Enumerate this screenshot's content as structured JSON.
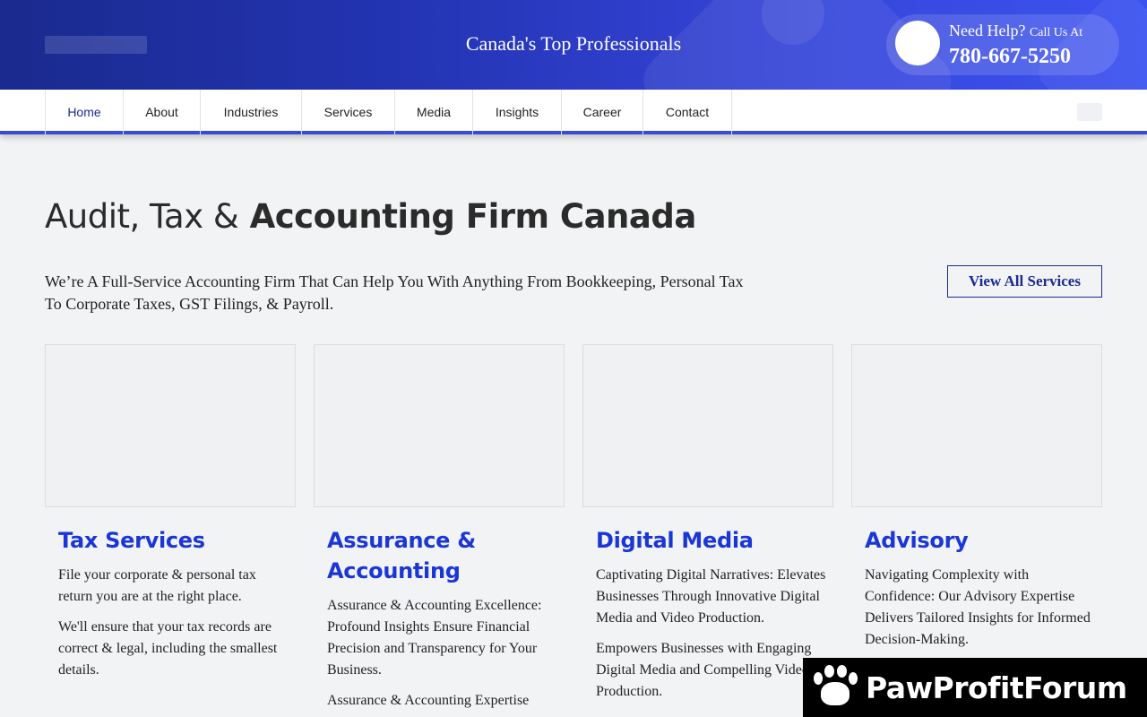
{
  "header": {
    "tagline": "Canada's Top Professionals",
    "help_label": "Need Help?",
    "help_sub": "Call Us At",
    "phone": "780-667-5250"
  },
  "nav": {
    "items": [
      {
        "label": "Home"
      },
      {
        "label": "About"
      },
      {
        "label": "Industries"
      },
      {
        "label": "Services"
      },
      {
        "label": "Media"
      },
      {
        "label": "Insights"
      },
      {
        "label": "Career"
      },
      {
        "label": "Contact"
      }
    ]
  },
  "main": {
    "title_light": "Audit, Tax &",
    "title_bold": "Accounting Firm Canada",
    "intro": "We’re A Full-Service Accounting Firm That Can Help You With Anything From Bookkeeping, Personal Tax To Corporate Taxes, GST Filings, & Payroll.",
    "view_all_label": "View All Services",
    "cards": [
      {
        "title": "Tax Services",
        "paragraphs": [
          "File your corporate & personal tax return you are at the right place.",
          "We'll ensure that your tax records are correct & legal, including the smallest details."
        ]
      },
      {
        "title": "Assurance & Accounting",
        "paragraphs": [
          "Assurance & Accounting Excellence: Profound Insights Ensure Financial Precision and Transparency for Your Business.",
          "Assurance & Accounting Expertise"
        ]
      },
      {
        "title": "Digital Media",
        "paragraphs": [
          "Captivating Digital Narratives: Elevates Businesses Through Innovative Digital Media and Video Production.",
          "Empowers Businesses with Engaging Digital Media and Compelling Video Production."
        ]
      },
      {
        "title": "Advisory",
        "paragraphs": [
          "Navigating Complexity with Confidence: Our Advisory Expertise Delivers Tailored Insights for Informed Decision-Making."
        ]
      }
    ]
  },
  "watermark": {
    "text": "PawProfitForum",
    "icon": "paw-icon"
  }
}
